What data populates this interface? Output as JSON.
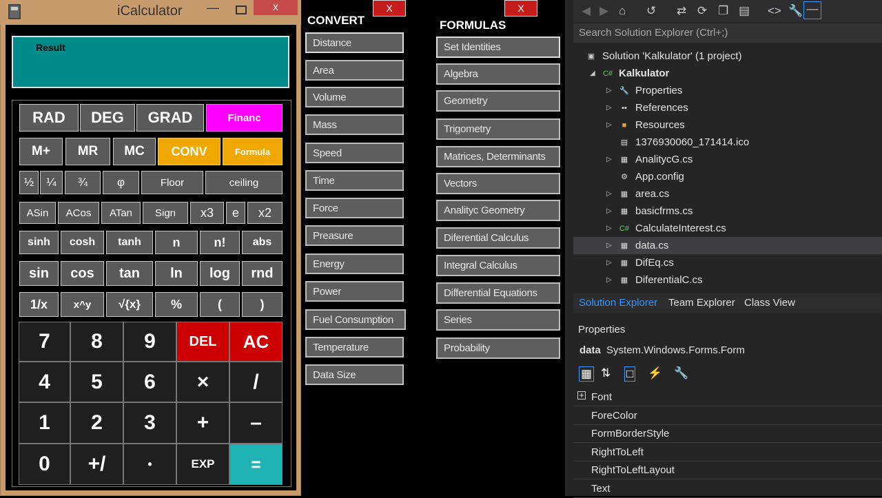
{
  "calculator": {
    "title": "iCalculator",
    "close": "x",
    "minimize": "—",
    "display_label": "Result",
    "rows": {
      "r1": [
        "RAD",
        "DEG",
        "GRAD",
        "Financ"
      ],
      "r2": [
        "M+",
        "MR",
        "MC",
        "CONV",
        "Formula"
      ],
      "r3": [
        "½",
        "¼",
        "¾",
        "φ",
        "Floor",
        "ceiling"
      ],
      "r4": [
        "ASin",
        "ACos",
        "ATan",
        "Sign",
        "x3",
        "e",
        "x2"
      ],
      "r5": [
        "sinh",
        "cosh",
        "tanh",
        "n",
        "n!",
        "abs"
      ],
      "r6": [
        "sin",
        "cos",
        "tan",
        "ln",
        "log",
        "rnd"
      ],
      "r7": [
        "1/x",
        "x^y",
        "√{x}",
        "%",
        "(",
        ")"
      ],
      "d1": [
        "7",
        "8",
        "9",
        "DEL",
        "AC"
      ],
      "d2": [
        "4",
        "5",
        "6",
        "×",
        "/"
      ],
      "d3": [
        "1",
        "2",
        "3",
        "+",
        "–"
      ],
      "d4": [
        "0",
        "+/",
        "•",
        "EXP",
        "="
      ]
    },
    "colors": {
      "financ": "#ff00ff",
      "conv": "#f0a800",
      "del": "#cc0000",
      "equals": "#1fb3b3",
      "display": "#008a8a"
    }
  },
  "convert": {
    "header": "CONVERT",
    "close": "X",
    "items": [
      "Distance",
      "Area",
      "Volume",
      "Mass",
      "Speed",
      "Time",
      "Force",
      "Preasure",
      "Energy",
      "Power",
      "Fuel Consumption",
      "Temperature",
      "Data Size"
    ]
  },
  "formulas": {
    "header": "FORMULAS",
    "close": "X",
    "items": [
      "Set Identities",
      "Algebra",
      "Geometry",
      "Trigometry",
      "Matrices, Determinants",
      "Vectors",
      "Analityc Geometry",
      "Diferential Calculus",
      "Integral Calculus",
      "Differential Equations",
      "Series",
      "Probability"
    ]
  },
  "solution_explorer": {
    "search_placeholder": "Search Solution Explorer (Ctrl+;)",
    "solution": "Solution 'Kalkulator' (1 project)",
    "project": "Kalkulator",
    "items": [
      "Properties",
      "References",
      "Resources",
      "1376930060_171414.ico",
      "AnalitycG.cs",
      "App.config",
      "area.cs",
      "basicfrms.cs",
      "CalculateInterest.cs",
      "data.cs",
      "DifEq.cs",
      "DiferentialC.cs"
    ],
    "tabs": [
      "Solution Explorer",
      "Team Explorer",
      "Class View"
    ]
  },
  "properties": {
    "title": "Properties",
    "object_name": "data",
    "object_type": "System.Windows.Forms.Form",
    "rows": [
      "Font",
      "ForeColor",
      "FormBorderStyle",
      "RightToLeft",
      "RightToLeftLayout",
      "Text"
    ]
  }
}
